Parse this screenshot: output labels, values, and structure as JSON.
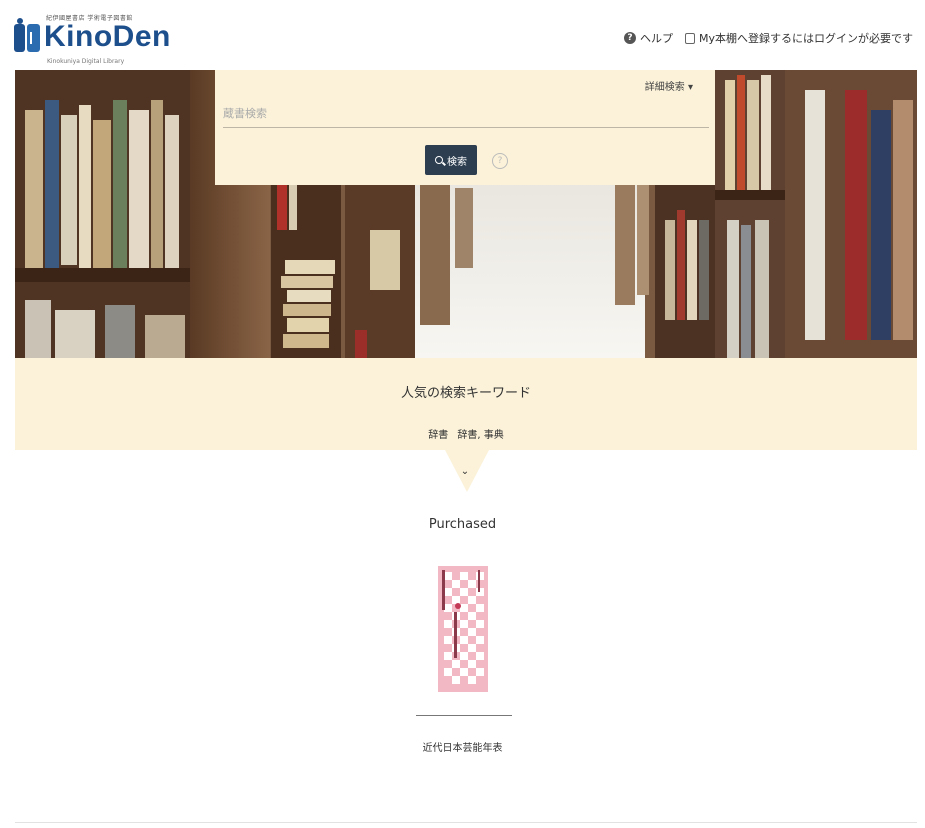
{
  "header": {
    "logo_small_text": "紀伊國屋書店 学術電子図書館",
    "logo_name": "KinoDen",
    "logo_sub": "Kinokuniya Digital Library",
    "help_label": "ヘルプ",
    "mybook_label": "My本棚へ登録するにはログインが必要です"
  },
  "search": {
    "advanced_label": "詳細検索 ▾",
    "placeholder": "蔵書検索",
    "button_label": "検索",
    "help_glyph": "?"
  },
  "keywords": {
    "title": "人気の検索キーワード",
    "tags": [
      "辞書",
      "辞書, 事典"
    ],
    "toggle": "⌄"
  },
  "purchased": {
    "title": "Purchased",
    "books": [
      {
        "title": "近代日本芸能年表"
      }
    ]
  },
  "colors": {
    "brand": "#1d4f8c",
    "panel": "#fbf2d9",
    "button": "#2c3e50",
    "cover": "#f2b8c4"
  }
}
